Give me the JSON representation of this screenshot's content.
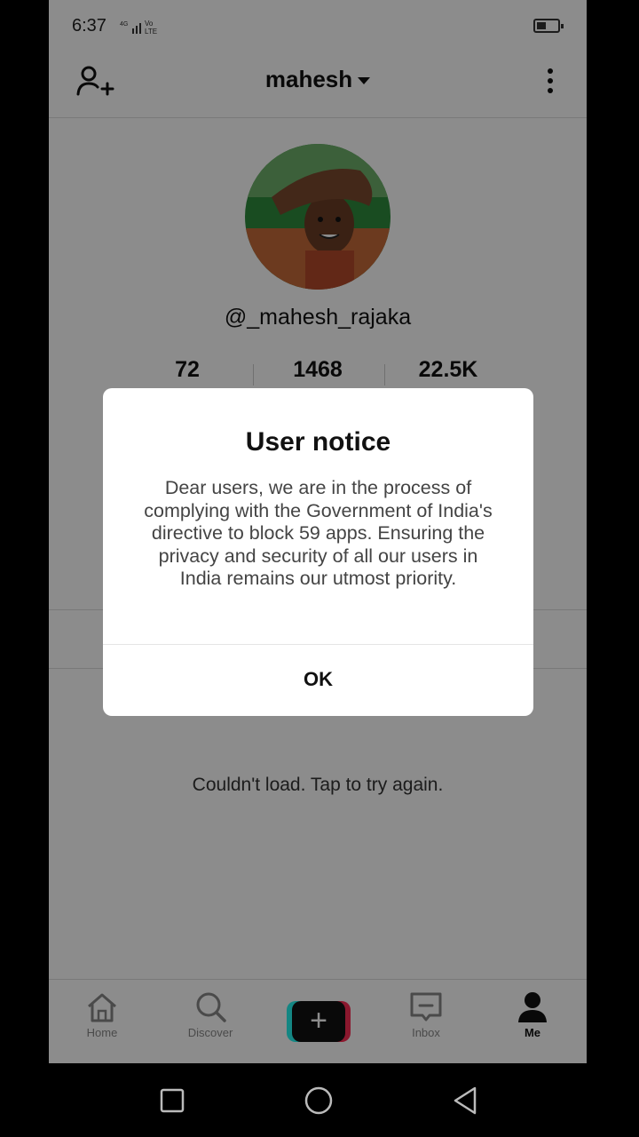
{
  "status_bar": {
    "time": "6:37",
    "network": "4G Vo LTE"
  },
  "header": {
    "username": "mahesh"
  },
  "profile": {
    "handle": "@_mahesh_rajaka",
    "stats": {
      "following": "72",
      "followers": "1468",
      "likes": "22.5K"
    },
    "load_error": "Couldn't load. Tap to try again."
  },
  "dialog": {
    "title": "User notice",
    "body": "Dear users, we are in the process of complying with the Government of India's directive to block 59 apps. Ensuring the privacy and security of all our users in India remains our utmost priority.",
    "ok_label": "OK"
  },
  "bottom_nav": {
    "home": "Home",
    "discover": "Discover",
    "create": "+",
    "inbox": "Inbox",
    "me": "Me"
  },
  "colors": {
    "accent_cyan": "#25f4ee",
    "accent_pink": "#fe2c55",
    "text": "#111111"
  }
}
